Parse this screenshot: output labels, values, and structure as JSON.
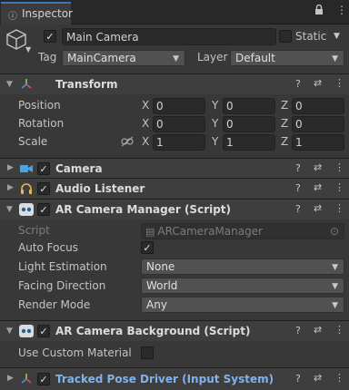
{
  "window": {
    "tab_label": "Inspector",
    "tab_icon": "ⓘ",
    "lock_glyph": "🔒",
    "more_glyph": "⋮"
  },
  "object": {
    "name": "Main Camera",
    "static_label": "Static",
    "tag_label": "Tag",
    "tag_value": "MainCamera",
    "layer_label": "Layer",
    "layer_value": "Default"
  },
  "transform": {
    "title": "Transform",
    "rows": [
      {
        "label": "Position",
        "x": "0",
        "y": "0",
        "z": "0"
      },
      {
        "label": "Rotation",
        "x": "0",
        "y": "0",
        "z": "0"
      },
      {
        "label": "Scale",
        "x": "1",
        "y": "1",
        "z": "1"
      }
    ],
    "axis": {
      "x": "X",
      "y": "Y",
      "z": "Z"
    }
  },
  "components": {
    "camera": {
      "title": "Camera"
    },
    "audio_listener": {
      "title": "Audio Listener"
    },
    "ar_camera_manager": {
      "title": "AR Camera Manager (Script)",
      "script_label": "Script",
      "script_value": "ARCameraManager",
      "auto_focus_label": "Auto Focus",
      "light_estimation_label": "Light Estimation",
      "light_estimation_value": "None",
      "facing_direction_label": "Facing Direction",
      "facing_direction_value": "World",
      "render_mode_label": "Render Mode",
      "render_mode_value": "Any"
    },
    "ar_camera_background": {
      "title": "AR Camera Background (Script)",
      "use_custom_material_label": "Use Custom Material"
    },
    "tracked_pose_driver": {
      "title": "Tracked Pose Driver (Input System)"
    }
  },
  "colors": {
    "accent": "#3a79bb",
    "link_title": "#7fb3ee",
    "panel": "#383838",
    "header": "#3e3e3e"
  },
  "glyphs": {
    "check": "✓",
    "question": "?",
    "presets": "⇄",
    "more": "⋮",
    "dropdown": "▼",
    "fold_open": "▼",
    "fold_closed": "▶",
    "target": "⊙"
  }
}
